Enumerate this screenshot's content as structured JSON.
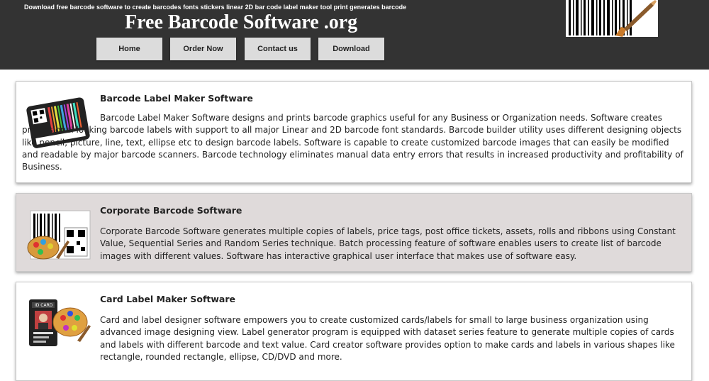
{
  "header": {
    "tagline": "Download free barcode software to create barcodes fonts stickers linear 2D bar code label maker tool print generates barcode",
    "title": "Free Barcode Software .org",
    "background": "#333333"
  },
  "nav": [
    {
      "label": "Home"
    },
    {
      "label": "Order Now"
    },
    {
      "label": "Contact us"
    },
    {
      "label": "Download"
    }
  ],
  "cards": [
    {
      "title": "Barcode Label Maker Software",
      "icon": "barcode-label-icon",
      "background": "#ffffff",
      "text": "Barcode Label Maker Software designs and prints barcode graphics useful for any Business or Organization needs. Software creates professional looking barcode labels with support to all major Linear and 2D barcode font standards. Barcode builder utility uses different designing objects like pencil, picture, line, text, ellipse etc to design barcode labels. Software is capable to create customized barcode images that can easily be modified and readable by major barcode scanners. Barcode technology eliminates manual data entry errors that results in increased productivity and profitability of Business."
    },
    {
      "title": "Corporate Barcode Software",
      "icon": "corporate-barcode-icon",
      "background": "#dfdada",
      "text": "Corporate Barcode Software generates multiple copies of labels, price tags, post office tickets, assets, rolls and ribbons using Constant Value, Sequential Series and Random Series technique. Batch processing feature of software enables users to create list of barcode images with different values. Software has interactive graphical user interface that makes use of software easy."
    },
    {
      "title": "Card Label Maker Software",
      "icon": "id-card-icon",
      "background": "#ffffff",
      "text": "Card and label designer software empowers you to create customized cards/labels for small to large business organization using advanced image designing view. Label generator program is equipped with dataset series feature to generate multiple copies of cards and labels with different barcode and text value. Card creator software provides option to make cards and labels in various shapes like rectangle, rounded rectangle, ellipse, CD/DVD and more."
    }
  ]
}
